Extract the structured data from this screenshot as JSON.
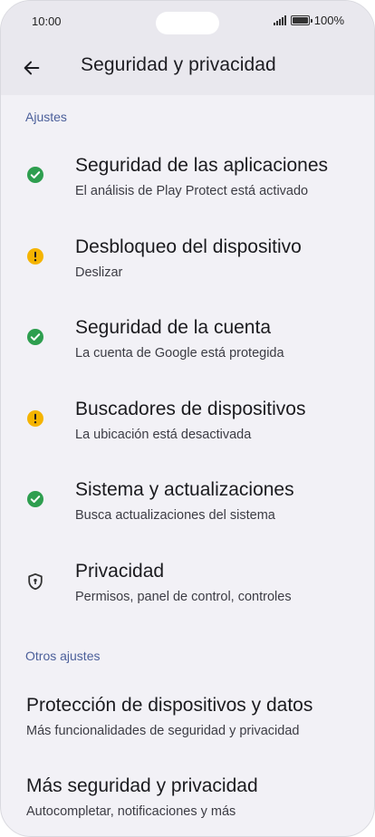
{
  "status_bar": {
    "time": "10:00",
    "battery": "100%"
  },
  "header": {
    "title": "Seguridad y privacidad",
    "back_icon": "arrow-left-icon"
  },
  "sections": [
    {
      "label": "Ajustes",
      "items": [
        {
          "title": "Seguridad de las aplicaciones",
          "subtitle": "El análisis de Play Protect está activado",
          "icon": "check-circle-icon",
          "status_color": "#2e9e4f"
        },
        {
          "title": "Desbloqueo del dispositivo",
          "subtitle": "Deslizar",
          "icon": "warning-circle-icon",
          "status_color": "#f5b400"
        },
        {
          "title": "Seguridad de la cuenta",
          "subtitle": "La cuenta de Google está protegida",
          "icon": "check-circle-icon",
          "status_color": "#2e9e4f"
        },
        {
          "title": "Buscadores de dispositivos",
          "subtitle": "La ubicación está desactivada",
          "icon": "warning-circle-icon",
          "status_color": "#f5b400"
        },
        {
          "title": "Sistema y actualizaciones",
          "subtitle": "Busca actualizaciones del sistema",
          "icon": "check-circle-icon",
          "status_color": "#2e9e4f"
        },
        {
          "title": "Privacidad",
          "subtitle": "Permisos, panel de control, controles",
          "icon": "shield-lock-icon",
          "status_color": "#333333"
        }
      ]
    },
    {
      "label": "Otros ajustes",
      "items": [
        {
          "title": "Protección de dispositivos y datos",
          "subtitle": "Más funcionalidades de seguridad y privacidad"
        },
        {
          "title": "Más seguridad y privacidad",
          "subtitle": "Autocompletar, notificaciones y más"
        }
      ]
    }
  ],
  "colors": {
    "accent": "#4b5f9a",
    "ok": "#2e9e4f",
    "warning": "#f5b400",
    "background": "#f2f1f6"
  }
}
